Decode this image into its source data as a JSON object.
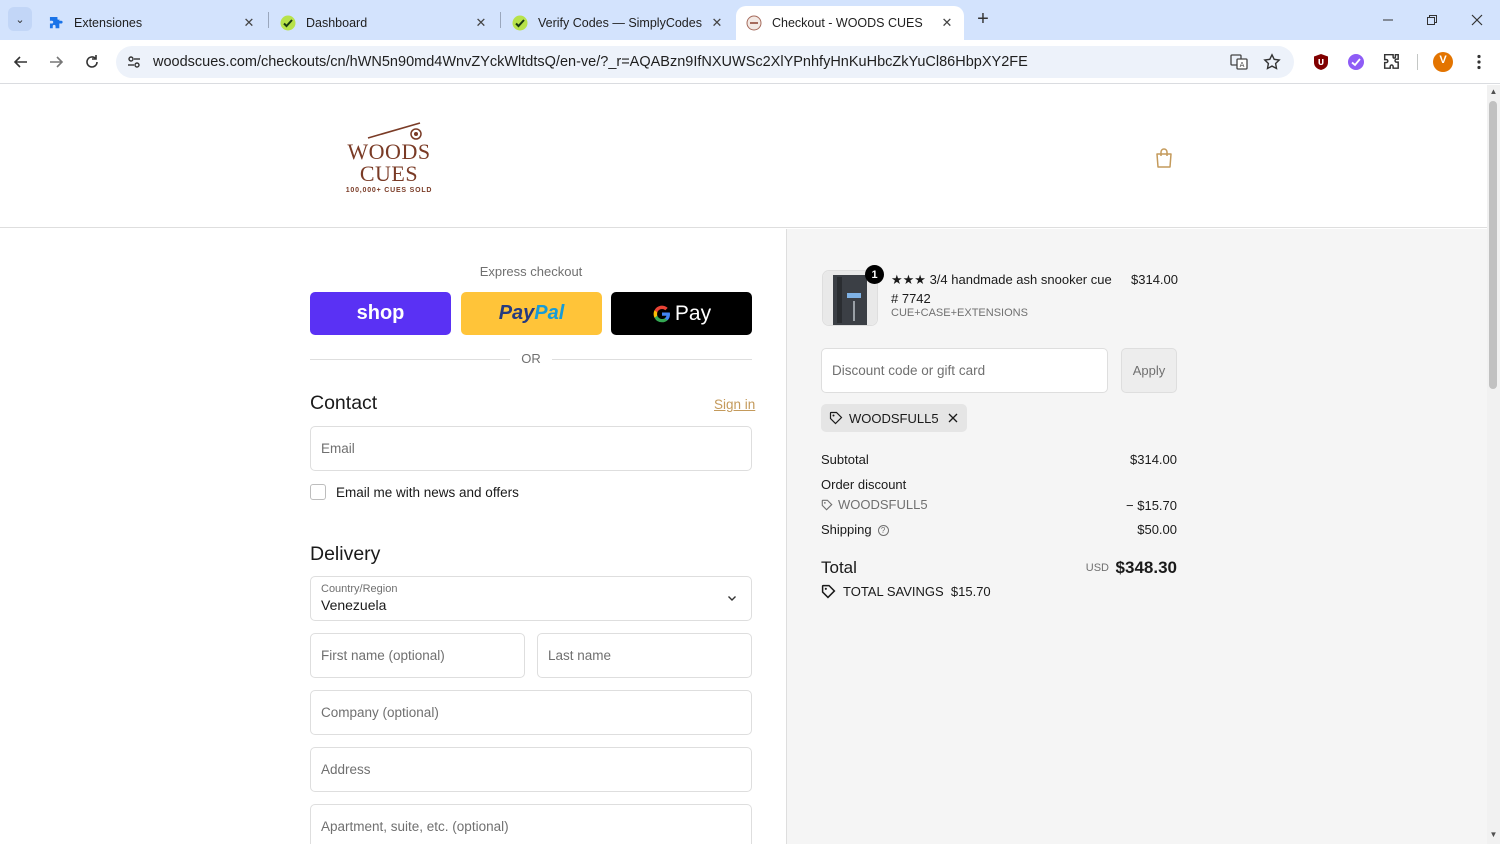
{
  "browser": {
    "tabs": [
      {
        "title": "Extensiones",
        "active": false
      },
      {
        "title": "Dashboard",
        "active": false
      },
      {
        "title": "Verify Codes — SimplyCodes",
        "active": false
      },
      {
        "title": "Checkout - WOODS CUES",
        "active": true
      }
    ],
    "url": "woodscues.com/checkouts/cn/hWN5n90md4WnvZYckWltdtsQ/en-ve/?_r=AQABzn9IfNXUWSc2XlYPnhfyHnKuHbcZkYuCl86HbpXY2FE",
    "profile_initial": "V"
  },
  "store": {
    "logo_name": "WOODS CUES",
    "logo_tagline": "100,000+ CUES SOLD"
  },
  "express": {
    "title": "Express checkout",
    "shop_label": "shop",
    "paypal_label_1": "Pay",
    "paypal_label_2": "Pal",
    "gpay_label": "Pay",
    "or_label": "OR"
  },
  "contact": {
    "heading": "Contact",
    "signin": "Sign in",
    "email_placeholder": "Email",
    "news_label": "Email me with news and offers"
  },
  "delivery": {
    "heading": "Delivery",
    "country_label": "Country/Region",
    "country_value": "Venezuela",
    "first_name_placeholder": "First name (optional)",
    "last_name_placeholder": "Last name",
    "company_placeholder": "Company (optional)",
    "address_placeholder": "Address",
    "apartment_placeholder": "Apartment, suite, etc. (optional)"
  },
  "summary": {
    "item": {
      "quantity": "1",
      "title": "★★★ 3/4 handmade ash snooker cue # 7742",
      "variant": "CUE+CASE+EXTENSIONS",
      "price": "$314.00"
    },
    "discount_placeholder": "Discount code or gift card",
    "apply_label": "Apply",
    "applied_code": "WOODSFULL5",
    "subtotal_label": "Subtotal",
    "subtotal_value": "$314.00",
    "order_discount_label": "Order discount",
    "discount_code": "WOODSFULL5",
    "discount_value": "− $15.70",
    "shipping_label": "Shipping",
    "shipping_value": "$50.00",
    "total_label": "Total",
    "currency": "USD",
    "total_value": "$348.30",
    "savings_label": "TOTAL SAVINGS",
    "savings_value": "$15.70"
  },
  "colors": {
    "shop_purple": "#5a31f4",
    "paypal_yellow": "#ffc439",
    "brand_brown": "#7a3b26",
    "link_gold": "#c49a5b",
    "tab_bar": "#d3e3fd"
  }
}
